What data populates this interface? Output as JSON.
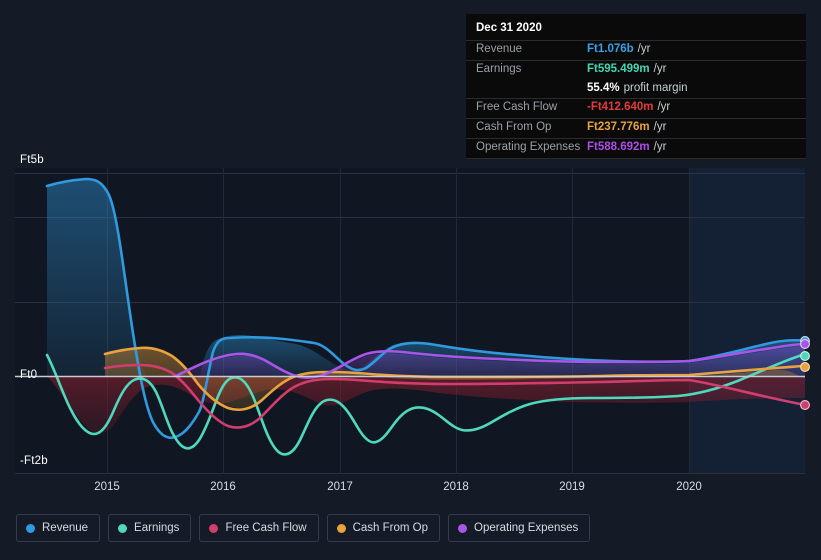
{
  "axis": {
    "y_top_label": "Ft5b",
    "y_zero_label": "Ft0",
    "y_bottom_label": "-Ft2b",
    "x_labels": [
      "2015",
      "2016",
      "2017",
      "2018",
      "2019",
      "2020"
    ]
  },
  "tooltip": {
    "date": "Dec 31 2020",
    "rows": [
      {
        "key": "Revenue",
        "value": "Ft1.076b",
        "unit": "/yr",
        "color": "#3aa0e8"
      },
      {
        "key": "Earnings",
        "value": "Ft595.499m",
        "unit": "/yr",
        "color": "#46d6b4"
      },
      {
        "key": "Free Cash Flow",
        "value": "-Ft412.640m",
        "unit": "/yr",
        "color": "#e33b3b"
      },
      {
        "key": "Cash From Op",
        "value": "Ft237.776m",
        "unit": "/yr",
        "color": "#e8a33d"
      },
      {
        "key": "Operating Expenses",
        "value": "Ft588.692m",
        "unit": "/yr",
        "color": "#b04de8"
      }
    ],
    "margin_value": "55.4%",
    "margin_label": "profit margin"
  },
  "legend": [
    {
      "label": "Revenue",
      "color": "#2f9ae0"
    },
    {
      "label": "Earnings",
      "color": "#4fd9bb"
    },
    {
      "label": "Free Cash Flow",
      "color": "#d13e6e"
    },
    {
      "label": "Cash From Op",
      "color": "#e8a33d"
    },
    {
      "label": "Operating Expenses",
      "color": "#a855e8"
    }
  ],
  "chart_data": {
    "type": "line",
    "title": "",
    "xlabel": "",
    "ylabel": "",
    "currency": "Ft (HUF)",
    "ylim": [
      -2000000000,
      5000000000
    ],
    "ytick_labels": [
      "Ft5b",
      "Ft0",
      "-Ft2b"
    ],
    "ytick_values": [
      5000000000,
      0,
      -2000000000
    ],
    "grid": true,
    "legend_position": "bottom-left",
    "highlight_band": {
      "from": "2020",
      "to": "end"
    },
    "x": [
      "2014.35",
      "2014.55",
      "2014.75",
      "2015.00",
      "2015.25",
      "2015.50",
      "2015.75",
      "2016.00",
      "2016.25",
      "2016.50",
      "2016.75",
      "2017.00",
      "2017.25",
      "2017.50",
      "2017.75",
      "2018.00",
      "2018.25",
      "2018.50",
      "2018.75",
      "2019.00",
      "2019.25",
      "2019.50",
      "2019.75",
      "2020.00",
      "2020.25",
      "2020.50",
      "2020.75",
      "2020.95"
    ],
    "series": [
      {
        "name": "Revenue",
        "color": "#2f9ae0",
        "end_value_label": "Ft1.076b",
        "values": [
          4450000000,
          4620000000,
          4650000000,
          2300000000,
          -1250000000,
          -1900000000,
          -1950000000,
          700000000,
          780000000,
          760000000,
          680000000,
          180000000,
          250000000,
          640000000,
          700000000,
          660000000,
          620000000,
          600000000,
          580000000,
          560000000,
          540000000,
          530000000,
          540000000,
          560000000,
          720000000,
          900000000,
          1020000000,
          1076000000
        ]
      },
      {
        "name": "Earnings",
        "color": "#4fd9bb",
        "end_value_label": "Ft595.499m",
        "values": [
          210000000,
          -600000000,
          -1500000000,
          -1720000000,
          -520000000,
          -880000000,
          -900000000,
          -80000000,
          -660000000,
          -1250000000,
          -1680000000,
          -1700000000,
          -1160000000,
          -600000000,
          -420000000,
          -520000000,
          -850000000,
          -1100000000,
          -1130000000,
          -980000000,
          -700000000,
          -420000000,
          -300000000,
          -260000000,
          -140000000,
          160000000,
          430000000,
          595499000
        ]
      },
      {
        "name": "Free Cash Flow",
        "color": "#d13e6e",
        "end_value_label": "-Ft412.640m",
        "values": [
          null,
          null,
          null,
          180000000,
          165000000,
          150000000,
          60000000,
          -160000000,
          -440000000,
          -640000000,
          -700000000,
          -300000000,
          -40000000,
          -60000000,
          -80000000,
          -60000000,
          -40000000,
          -20000000,
          -10000000,
          0,
          10000000,
          20000000,
          20000000,
          10000000,
          -110000000,
          -240000000,
          -350000000,
          -412640000
        ]
      },
      {
        "name": "Cash From Op",
        "color": "#e8a33d",
        "end_value_label": "Ft237.776m",
        "values": [
          null,
          null,
          null,
          300000000,
          340000000,
          380000000,
          300000000,
          -60000000,
          -400000000,
          -600000000,
          -580000000,
          -200000000,
          20000000,
          60000000,
          80000000,
          100000000,
          110000000,
          120000000,
          130000000,
          140000000,
          150000000,
          150000000,
          150000000,
          150000000,
          170000000,
          200000000,
          225000000,
          237776000
        ]
      },
      {
        "name": "Operating Expenses",
        "color": "#a855e8",
        "end_value_label": "Ft588.692m",
        "values": [
          null,
          null,
          null,
          null,
          60000000,
          240000000,
          330000000,
          400000000,
          420000000,
          340000000,
          120000000,
          60000000,
          240000000,
          440000000,
          470000000,
          440000000,
          420000000,
          400000000,
          390000000,
          380000000,
          380000000,
          380000000,
          380000000,
          390000000,
          450000000,
          510000000,
          560000000,
          588692000
        ]
      }
    ]
  }
}
